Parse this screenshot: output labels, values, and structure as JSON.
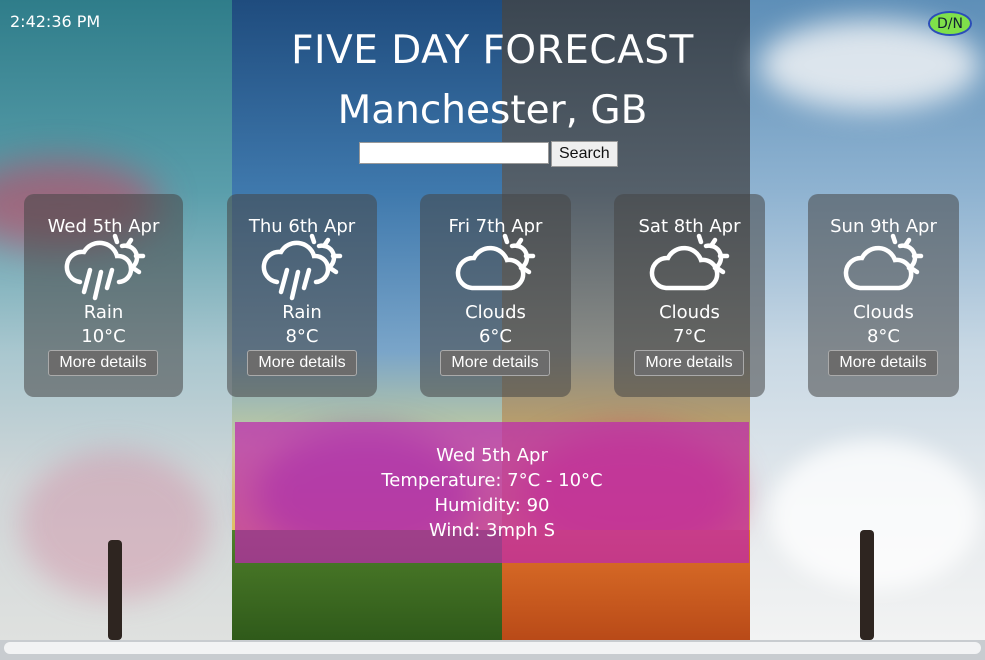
{
  "clock": "2:42:36 PM",
  "toggle_label": "D/N",
  "title": "FIVE DAY FORECAST",
  "location": "Manchester, GB",
  "search": {
    "placeholder": "",
    "value": "",
    "button_label": "Search"
  },
  "forecast": [
    {
      "day": "Wed 5th Apr",
      "condition": "Rain",
      "temp": "10°C",
      "icon": "rain-icon",
      "more_label": "More details"
    },
    {
      "day": "Thu 6th Apr",
      "condition": "Rain",
      "temp": "8°C",
      "icon": "rain-icon",
      "more_label": "More details"
    },
    {
      "day": "Fri 7th Apr",
      "condition": "Clouds",
      "temp": "6°C",
      "icon": "clouds-icon",
      "more_label": "More details"
    },
    {
      "day": "Sat 8th Apr",
      "condition": "Clouds",
      "temp": "7°C",
      "icon": "clouds-icon",
      "more_label": "More details"
    },
    {
      "day": "Sun 9th Apr",
      "condition": "Clouds",
      "temp": "8°C",
      "icon": "clouds-icon",
      "more_label": "More details"
    }
  ],
  "details": {
    "date": "Wed 5th Apr",
    "temperature": "Temperature: 7°C - 10°C",
    "humidity": "Humidity: 90",
    "wind": "Wind: 3mph S"
  },
  "colors": {
    "details_panel": "#be28af",
    "toggle_bg": "#7fe04a",
    "toggle_border": "#2b4db8"
  }
}
